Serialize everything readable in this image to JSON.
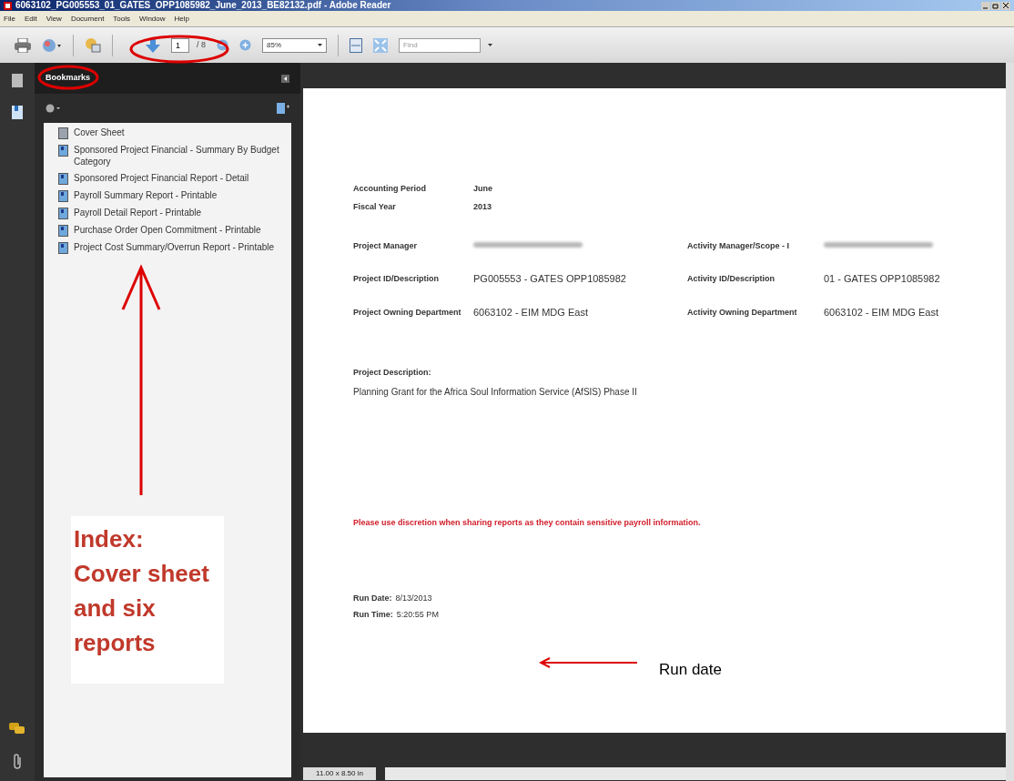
{
  "window": {
    "title": "6063102_PG005553_01_GATES_OPP1085982_June_2013_BE82132.pdf - Adobe Reader"
  },
  "menu": [
    "File",
    "Edit",
    "View",
    "Document",
    "Tools",
    "Window",
    "Help"
  ],
  "toolbar": {
    "page_field": {
      "value": "1"
    },
    "page_count": "/ 8",
    "zoom_field": {
      "value": "85%"
    },
    "find_field": {
      "placeholder": "Find"
    }
  },
  "sidebar": {
    "title": "Bookmarks",
    "bookmarks": [
      {
        "kind": "cover",
        "label": "Cover Sheet"
      },
      {
        "kind": "report",
        "label": "Sponsored Project Financial - Summary By Budget Category"
      },
      {
        "kind": "report",
        "label": "Sponsored Project Financial Report - Detail"
      },
      {
        "kind": "report",
        "label": "Payroll Summary Report - Printable"
      },
      {
        "kind": "report",
        "label": "Payroll Detail Report - Printable"
      },
      {
        "kind": "report",
        "label": "Purchase Order Open Commitment - Printable"
      },
      {
        "kind": "report",
        "label": "Project Cost Summary/Overrun Report - Printable"
      }
    ]
  },
  "document": {
    "period": [
      {
        "label": "Accounting Period",
        "value": "June"
      },
      {
        "label": "Fiscal Year",
        "value": "2013"
      }
    ],
    "rows": [
      [
        {
          "label": "Project Manager",
          "kind": "redacted"
        },
        {
          "label": "Activity Manager/Scope - I",
          "kind": "redacted"
        }
      ],
      [
        {
          "label": "Project ID/Description",
          "kind": "text",
          "value": "PG005553 - GATES OPP1085982"
        },
        {
          "label": "Activity ID/Description",
          "kind": "text",
          "value": "01 - GATES OPP1085982"
        }
      ],
      [
        {
          "label": "Project Owning Department",
          "kind": "text",
          "value": "6063102 - EIM MDG East"
        },
        {
          "label": "Activity Owning Department",
          "kind": "text",
          "value": "6063102 - EIM MDG East"
        }
      ]
    ],
    "description_label": "Project Description:",
    "description": "Planning Grant for the Africa Soul Information Service (AfSIS) Phase II",
    "warning": "Please use discretion when sharing reports as they contain sensitive payroll information.",
    "run_date": {
      "label": "Run Date:",
      "value": "8/13/2013"
    },
    "run_time": {
      "label": "Run Time:",
      "value": "5:20:55 PM"
    }
  },
  "status_bar": {
    "page_size": "11.00 x 8.50 in"
  },
  "annotations": {
    "index_note": [
      "Index:",
      "Cover sheet",
      "and six",
      "reports"
    ],
    "run_date_note": "Run date"
  }
}
